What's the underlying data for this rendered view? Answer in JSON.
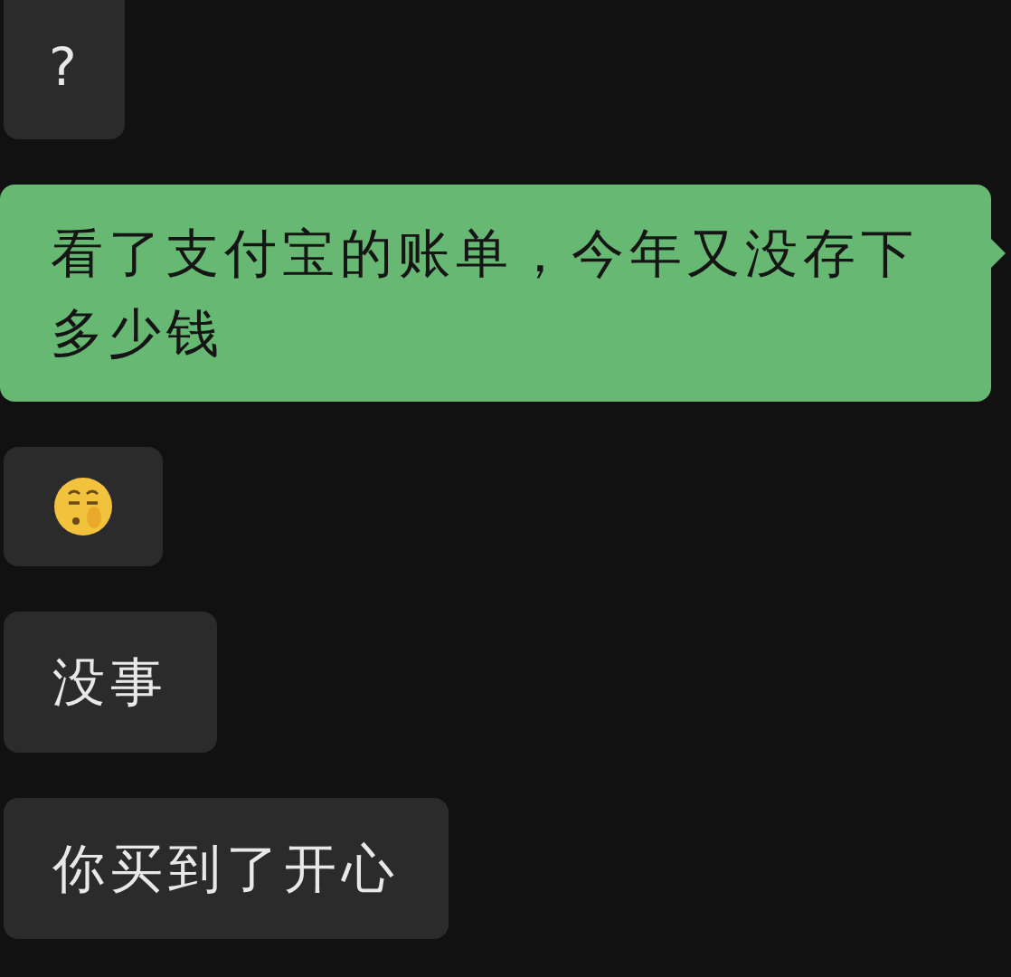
{
  "messages": [
    {
      "kind": "incoming",
      "text": "?"
    },
    {
      "kind": "outgoing",
      "text": "看了支付宝的账单，今年又没存下多少钱"
    },
    {
      "kind": "emoji"
    },
    {
      "kind": "incoming",
      "text": "没事"
    },
    {
      "kind": "incoming",
      "text": "你买到了开心"
    }
  ]
}
